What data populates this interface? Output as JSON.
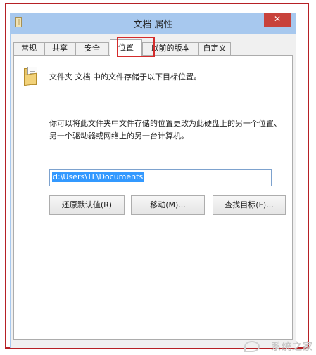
{
  "window": {
    "title": "文档 属性",
    "close_glyph": "✕"
  },
  "tabs": [
    {
      "label": "常规",
      "active": false
    },
    {
      "label": "共享",
      "active": false
    },
    {
      "label": "安全",
      "active": false
    },
    {
      "label": "位置",
      "active": true
    },
    {
      "label": "以前的版本",
      "active": false
    },
    {
      "label": "自定义",
      "active": false
    }
  ],
  "location_tab": {
    "header": "文件夹 文档 中的文件存储于以下目标位置。",
    "description": "你可以将此文件夹中文件存储的位置更改为此硬盘上的另一个位置、另一个驱动器或网络上的另一台计算机。",
    "path_value": "d:\\Users\\TL\\Documents",
    "buttons": {
      "restore": "还原默认值(R)",
      "move": "移动(M)...",
      "find_target": "查找目标(F)..."
    }
  },
  "watermark": "系统之家",
  "colors": {
    "frame_red": "#b62025",
    "highlight_red": "#d42b2b",
    "titlebar": "#a7c8ee",
    "close": "#c8423b",
    "selection": "#3399ff"
  },
  "icons": {
    "title": "folder-properties-icon",
    "folder": "documents-folder-icon"
  }
}
